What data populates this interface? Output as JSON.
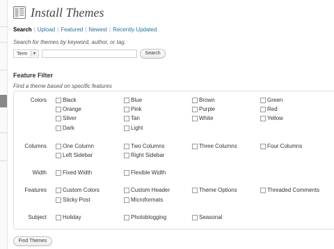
{
  "header": {
    "title": "Install Themes",
    "icon": "appearance-icon"
  },
  "subnav": [
    {
      "label": "Search",
      "current": true
    },
    {
      "label": "Upload",
      "current": false
    },
    {
      "label": "Featured",
      "current": false
    },
    {
      "label": "Newest",
      "current": false
    },
    {
      "label": "Recently Updated",
      "current": false
    }
  ],
  "search": {
    "description": "Search for themes by keyword, author, or tag.",
    "type_selected": "Term",
    "query_value": "",
    "button_label": "Search"
  },
  "feature_filter": {
    "title": "Feature Filter",
    "description": "Find a theme based on specific features",
    "groups": [
      {
        "label": "Colors",
        "options": [
          "Black",
          "Blue",
          "Brown",
          "Green",
          "Orange",
          "Pink",
          "Purple",
          "Red",
          "Silver",
          "Tan",
          "White",
          "Yellow",
          "Dark",
          "Light"
        ]
      },
      {
        "label": "Columns",
        "options": [
          "One Column",
          "Two Columns",
          "Three Columns",
          "Four Columns",
          "Left Sidebar",
          "Right Sidebar"
        ]
      },
      {
        "label": "Width",
        "options": [
          "Fixed Width",
          "Flexible Width"
        ]
      },
      {
        "label": "Features",
        "options": [
          "Custom Colors",
          "Custom Header",
          "Theme Options",
          "Threaded Comments",
          "Sticky Post",
          "Microformats"
        ]
      },
      {
        "label": "Subject",
        "options": [
          "Holiday",
          "Photoblogging",
          "Seasonal"
        ]
      }
    ]
  },
  "find_button_label": "Find Themes",
  "colors": {
    "link": "#21759b",
    "border": "#dfdfdf"
  }
}
